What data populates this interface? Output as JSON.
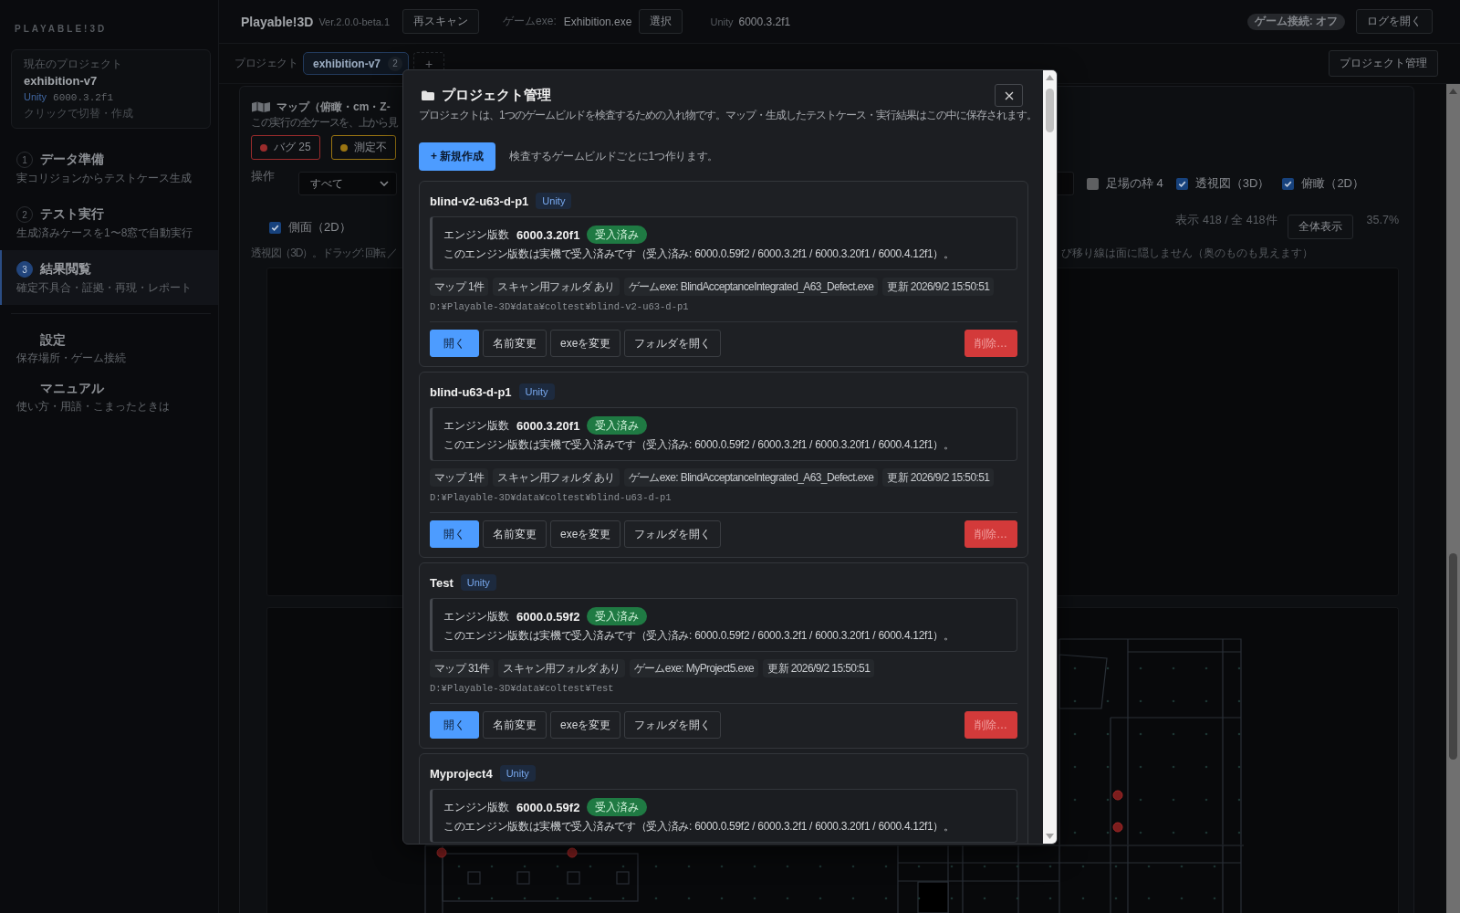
{
  "sidebar": {
    "brand": "PLAYABLE!3D",
    "current_project": {
      "label": "現在のプロジェクト",
      "name": "exhibition-v7",
      "engine": "Unity",
      "version": "6000.3.2f1",
      "hint": "クリックで切替・作成"
    },
    "steps": [
      {
        "number": "1",
        "title": "データ準備",
        "subtitle": "実コリジョンからテストケース生成",
        "selected": false
      },
      {
        "number": "2",
        "title": "テスト実行",
        "subtitle": "生成済みケースを1〜8窓で自動実行",
        "selected": false
      },
      {
        "number": "3",
        "title": "結果閲覧",
        "subtitle": "確定不具合・証拠・再現・レポート",
        "selected": true
      }
    ],
    "links": [
      {
        "title": "設定",
        "subtitle": "保存場所・ゲーム接続"
      },
      {
        "title": "マニュアル",
        "subtitle": "使い方・用語・こまったときは"
      }
    ]
  },
  "top_bar": {
    "app_name": "Playable!3D",
    "version": "Ver.2.0.0-beta.1",
    "rescan_button": "再スキャン",
    "exe_label": "ゲームexe:",
    "exe_value": "Exhibition.exe",
    "select_button": "選択",
    "engine_label": "Unity",
    "engine_value": "6000.3.2f1",
    "connection_badge": "ゲーム接続: オフ",
    "log_button": "ログを開く"
  },
  "project_bar": {
    "label": "プロジェクト",
    "tabs": [
      {
        "name": "exhibition-v7",
        "count": "2",
        "selected": true
      }
    ],
    "add_button": "+",
    "manage_button": "プロジェクト管理"
  },
  "map_panel": {
    "title": "マップ（俯瞰・cm・Z-",
    "subtitle": "この実行の全ケースを、上から見",
    "chips": [
      {
        "label": "バグ 25",
        "color": "#9b2c2c"
      },
      {
        "label": "測定不",
        "color": "#9a7512"
      }
    ],
    "operation_label": "操作",
    "operation_value": "すべて",
    "toggles": [
      {
        "label": "足場の枠 4",
        "checked": false
      },
      {
        "label": "透視図（3D）",
        "checked": true
      },
      {
        "label": "俯瞰（2D）",
        "checked": true
      },
      {
        "label": "側面（2D）",
        "checked": true
      }
    ],
    "count_text": "表示 418 / 全 418件",
    "fit_button": "全体表示",
    "zoom_text": "35.7%",
    "caption_left": "透視図（3D）。ドラッグ: 回転 ／",
    "caption_right": "び移り線は面に隠しません（奥のものも見えます）"
  },
  "dialog": {
    "title": "プロジェクト管理",
    "description": "プロジェクトは、1つのゲームビルドを検査するための入れ物です。マップ・生成したテストケース・実行結果はこの中に保存されます。",
    "create_button": "+ 新規作成",
    "create_hint": "検査するゲームビルドごとに1つ作ります。",
    "projects": [
      {
        "name": "blind-v2-u63-d-p1",
        "engine": "Unity",
        "engine_label": "エンジン版数",
        "version": "6000.3.20f1",
        "status": "受入済み",
        "note": "このエンジン版数は実機で受入済みです（受入済み: 6000.0.59f2 / 6000.3.2f1 / 6000.3.20f1 / 6000.4.12f1）。",
        "meta": [
          "マップ 1件",
          "スキャン用フォルダ あり",
          "ゲームexe: BlindAcceptanceIntegrated_A63_Defect.exe",
          "更新 2026/9/2 15:50:51"
        ],
        "path": "D:¥Playable-3D¥data¥coltest¥blind-v2-u63-d-p1",
        "actions": [
          {
            "label": "開く",
            "kind": "primary"
          },
          {
            "label": "名前変更",
            "kind": "default"
          },
          {
            "label": "exeを変更",
            "kind": "default"
          },
          {
            "label": "フォルダを開く",
            "kind": "default"
          },
          {
            "label": "削除…",
            "kind": "danger"
          }
        ]
      },
      {
        "name": "blind-u63-d-p1",
        "engine": "Unity",
        "engine_label": "エンジン版数",
        "version": "6000.3.20f1",
        "status": "受入済み",
        "note": "このエンジン版数は実機で受入済みです（受入済み: 6000.0.59f2 / 6000.3.2f1 / 6000.3.20f1 / 6000.4.12f1）。",
        "meta": [
          "マップ 1件",
          "スキャン用フォルダ あり",
          "ゲームexe: BlindAcceptanceIntegrated_A63_Defect.exe",
          "更新 2026/9/2 15:50:51"
        ],
        "path": "D:¥Playable-3D¥data¥coltest¥blind-u63-d-p1",
        "actions": [
          {
            "label": "開く",
            "kind": "primary"
          },
          {
            "label": "名前変更",
            "kind": "default"
          },
          {
            "label": "exeを変更",
            "kind": "default"
          },
          {
            "label": "フォルダを開く",
            "kind": "default"
          },
          {
            "label": "削除…",
            "kind": "danger"
          }
        ]
      },
      {
        "name": "Test",
        "engine": "Unity",
        "engine_label": "エンジン版数",
        "version": "6000.0.59f2",
        "status": "受入済み",
        "note": "このエンジン版数は実機で受入済みです（受入済み: 6000.0.59f2 / 6000.3.2f1 / 6000.3.20f1 / 6000.4.12f1）。",
        "meta": [
          "マップ 31件",
          "スキャン用フォルダ あり",
          "ゲームexe: MyProject5.exe",
          "更新 2026/9/2 15:50:51"
        ],
        "path": "D:¥Playable-3D¥data¥coltest¥Test",
        "actions": [
          {
            "label": "開く",
            "kind": "primary"
          },
          {
            "label": "名前変更",
            "kind": "default"
          },
          {
            "label": "exeを変更",
            "kind": "default"
          },
          {
            "label": "フォルダを開く",
            "kind": "default"
          },
          {
            "label": "削除…",
            "kind": "danger"
          }
        ]
      },
      {
        "name": "Myproject4",
        "engine": "Unity",
        "engine_label": "エンジン版数",
        "version": "6000.0.59f2",
        "status": "受入済み",
        "note": "このエンジン版数は実機で受入済みです（受入済み: 6000.0.59f2 / 6000.3.2f1 / 6000.3.20f1 / 6000.4.12f1）。"
      }
    ]
  }
}
